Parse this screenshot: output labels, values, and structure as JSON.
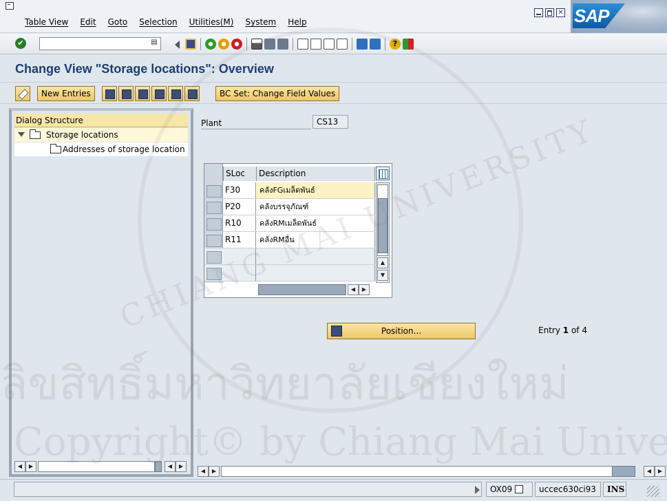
{
  "menubar": {
    "items": [
      "Table View",
      "Edit",
      "Goto",
      "Selection",
      "Utilities(M)",
      "System",
      "Help"
    ],
    "close_glyph": "✕",
    "logo": "SAP"
  },
  "stdbar": {
    "command_value": "",
    "check_glyph": "✔",
    "field_btn_glyph": "▤",
    "icons": [
      "enter-icon",
      "back-icon",
      "save-icon",
      "back-green-icon",
      "exit-yellow-icon",
      "cancel-red-icon",
      "print-icon",
      "find-icon",
      "find-next-icon",
      "first-page-icon",
      "previous-page-icon",
      "next-page-icon",
      "last-page-icon",
      "create-session-icon",
      "shortcut-icon",
      "help-icon",
      "layout-menu-icon"
    ],
    "help_glyph": "?"
  },
  "title": "Change View \"Storage locations\": Overview",
  "appbar": {
    "new_entries": "New Entries",
    "bc_set": "BC Set: Change Field Values"
  },
  "dialog_structure": {
    "header": "Dialog Structure",
    "items": [
      {
        "label": "Storage locations",
        "selected": true
      },
      {
        "label": "Addresses of storage location"
      }
    ]
  },
  "plant": {
    "label": "Plant",
    "value": "CS13"
  },
  "table": {
    "columns": [
      "SLoc",
      "Description"
    ],
    "rows": [
      {
        "sloc": "F30",
        "description": "คลังFGเมล็ดพันธ์"
      },
      {
        "sloc": "P20",
        "description": "คลังบรรจุภัณฑ์"
      },
      {
        "sloc": "R10",
        "description": "คลังRMเมล็ดพันธ์"
      },
      {
        "sloc": "R11",
        "description": "คลังRMอื่น"
      }
    ],
    "empty_rows": 2
  },
  "position_button": "Position...",
  "entry": {
    "prefix": "Entry",
    "current": "1",
    "of": "of",
    "total": "4"
  },
  "scroll_glyphs": {
    "left": "◀",
    "right": "▶",
    "up": "▲",
    "down": "▼"
  },
  "statusbar": {
    "transaction": "OX09",
    "server": "uccec630ci93",
    "mode": "INS"
  },
  "watermark": {
    "thai": "ลิขสิทธิ์มหาวิทยาลัยเชียงใหม่",
    "english": "Copyright© by Chiang Mai University",
    "arc": "CHIANG MAI UNIVERSITY"
  }
}
